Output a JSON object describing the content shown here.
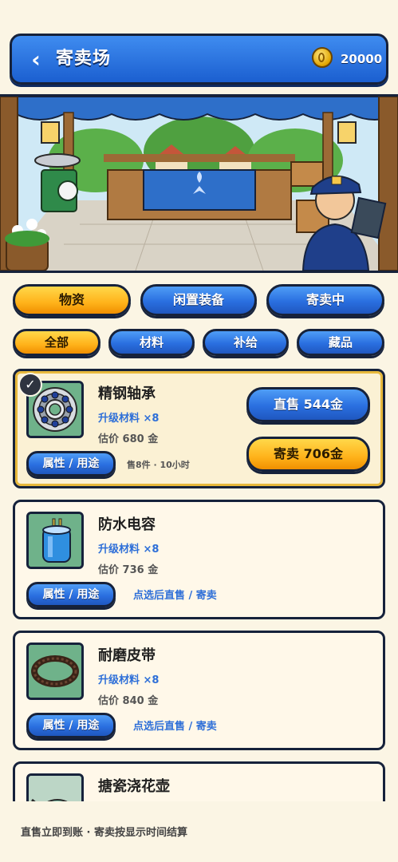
{
  "header": {
    "back_icon": "chevron-left-icon",
    "back_label": "‹",
    "title": "寄卖场",
    "gold": "20000",
    "coin_icon": "gold-coin-icon"
  },
  "tabs_primary": [
    {
      "label": "物资",
      "active": true
    },
    {
      "label": "闲置装备",
      "active": false
    },
    {
      "label": "寄卖中",
      "active": false
    }
  ],
  "tabs_secondary": [
    {
      "label": "全部",
      "active": true
    },
    {
      "label": "材料",
      "active": false
    },
    {
      "label": "补给",
      "active": false
    },
    {
      "label": "藏品",
      "active": false
    }
  ],
  "items": [
    {
      "name": "精钢轴承",
      "sub": "升级材料 ×8",
      "price": "估价 680 金",
      "attr_label": "属性 / 用途",
      "meta": "售8件 · 10小时",
      "direct_sell_label": "直售 544金",
      "consign_label": "寄卖 706金",
      "selected": true,
      "icon": "ball-bearing-icon"
    },
    {
      "name": "防水电容",
      "sub": "升级材料 ×8",
      "price": "估价 736 金",
      "attr_label": "属性 / 用途",
      "hint": "点选后直售 / 寄卖",
      "icon": "capacitor-icon"
    },
    {
      "name": "耐磨皮带",
      "sub": "升级材料 ×8",
      "price": "估价 840 金",
      "attr_label": "属性 / 用途",
      "hint": "点选后直售 / 寄卖",
      "icon": "belt-icon"
    },
    {
      "name": "搪瓷浇花壶",
      "icon": "watering-can-icon"
    }
  ],
  "footer": {
    "note": "直售立即到账 · 寄卖按显示时间结算"
  },
  "colors": {
    "accent_blue": "#2a6fe0",
    "accent_gold": "#ffb21a",
    "outline": "#16223b",
    "background": "#fbf5e4"
  }
}
